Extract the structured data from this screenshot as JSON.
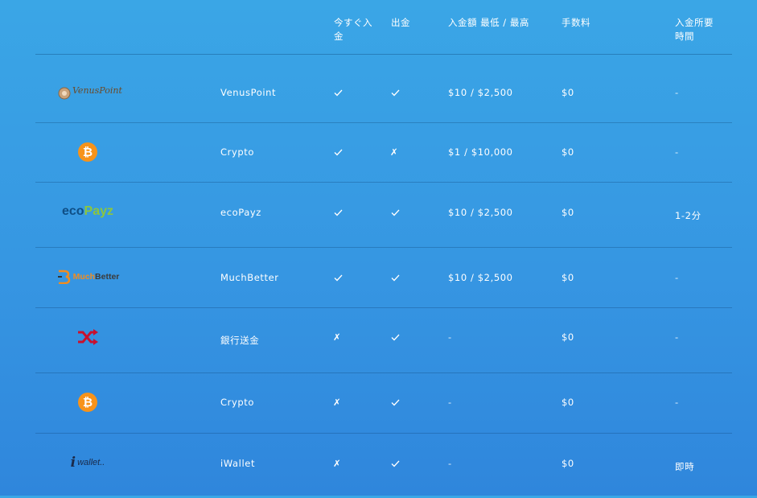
{
  "headers": {
    "instant": "今すぐ入金",
    "withdraw": "出金",
    "limits": "入金額 最低 / 最高",
    "fee": "手数料",
    "time": "入金所要時間"
  },
  "rows": [
    {
      "logo": "venuspoint-logo",
      "logo_text": "VenusPoint",
      "name": "VenusPoint",
      "instant": "✓",
      "withdraw": "✓",
      "limits": "$10 / $2,500",
      "fee": "$0",
      "time": "-"
    },
    {
      "logo": "bitcoin-icon",
      "logo_text": "",
      "name": "Crypto",
      "instant": "✓",
      "withdraw": "✗",
      "limits": "$1 / $10,000",
      "fee": "$0",
      "time": "-"
    },
    {
      "logo": "ecopayz-logo",
      "logo_text": "ecoPayz",
      "name": "ecoPayz",
      "instant": "✓",
      "withdraw": "✓",
      "limits": "$10 / $2,500",
      "fee": "$0",
      "time": "1-2分"
    },
    {
      "logo": "muchbetter-logo",
      "logo_text": "MuchBetter",
      "name": "MuchBetter",
      "instant": "✓",
      "withdraw": "✓",
      "limits": "$10 / $2,500",
      "fee": "$0",
      "time": "-"
    },
    {
      "logo": "shuffle-icon",
      "logo_text": "",
      "name": "銀行送金",
      "instant": "✗",
      "withdraw": "✓",
      "limits": "-",
      "fee": "$0",
      "time": "-"
    },
    {
      "logo": "bitcoin-icon",
      "logo_text": "",
      "name": "Crypto",
      "instant": "✗",
      "withdraw": "✓",
      "limits": "-",
      "fee": "$0",
      "time": "-"
    },
    {
      "logo": "iwallet-logo",
      "logo_text": "wallet..",
      "name": "iWallet",
      "instant": "✗",
      "withdraw": "✓",
      "limits": "-",
      "fee": "$0",
      "time": "即時"
    }
  ],
  "colors": {
    "bitcoin": "#f7931a",
    "ecopayz_dark": "#0f4f86",
    "ecopayz_green": "#8cc63f",
    "muchbetter_orange": "#f28c1e",
    "shuffle_red": "#c8102e",
    "iwallet_dark": "#1a2a4a"
  }
}
